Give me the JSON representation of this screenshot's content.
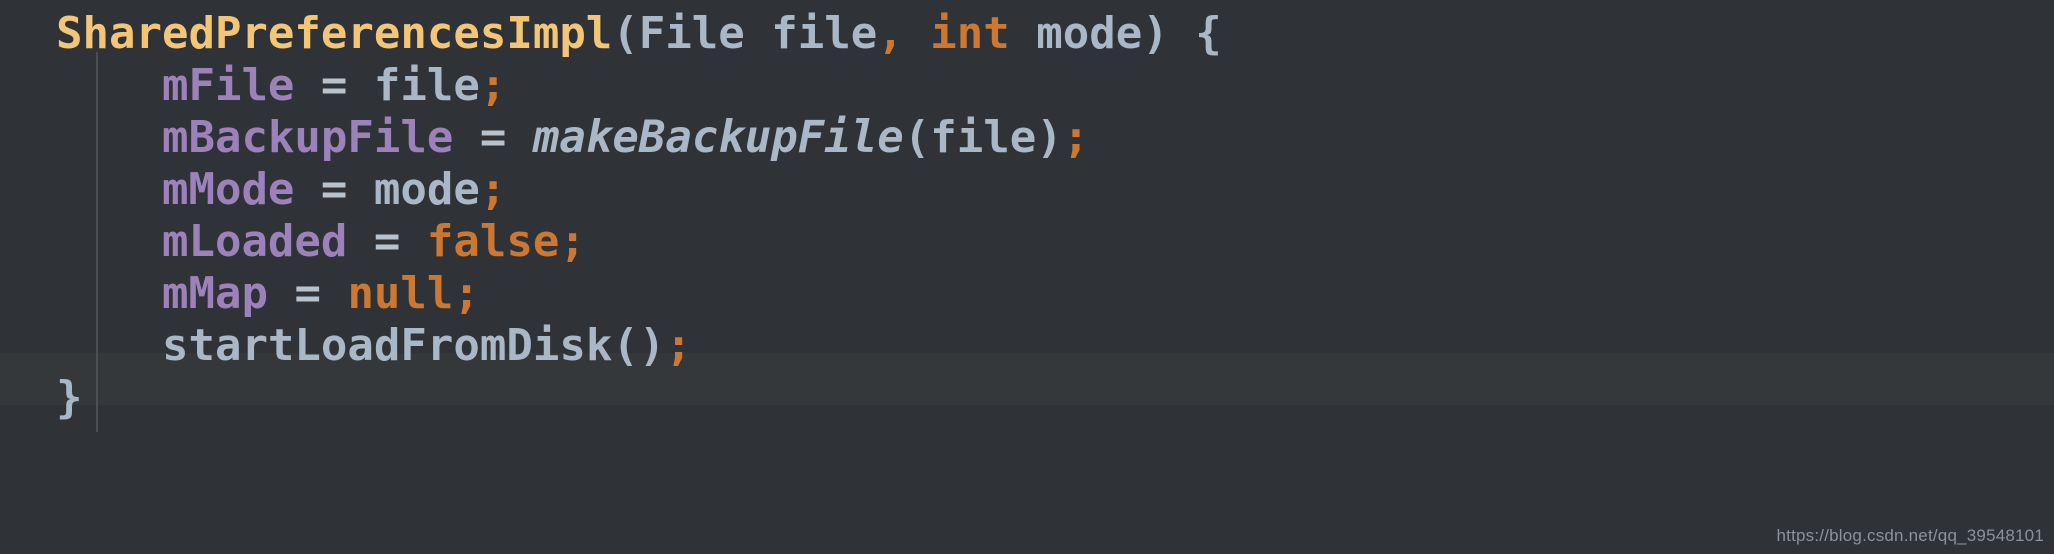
{
  "editor": {
    "theme_name": "darcula",
    "background_color": "#2f3337",
    "caret_line_color": "#35383a",
    "indent_guide_color": "#4a4f52",
    "highlighted_line_number": 6,
    "language": "java",
    "colors": {
      "constructor": "#f3c677",
      "keyword": "#cc7832",
      "punctuation": "#cc7832",
      "field": "#9d81bb",
      "plain": "#a9b7c6",
      "operator": "#b8c2cc",
      "static_method": "#a9b7c6"
    },
    "lines": [
      {
        "id": "line-1",
        "indent": "",
        "tokens": [
          {
            "text": "SharedPreferencesImpl",
            "kind": "ctor"
          },
          {
            "text": "(",
            "kind": "plain"
          },
          {
            "text": "File",
            "kind": "plain"
          },
          {
            "text": " ",
            "kind": "plain"
          },
          {
            "text": "file",
            "kind": "plain"
          },
          {
            "text": ",",
            "kind": "punc"
          },
          {
            "text": " ",
            "kind": "plain"
          },
          {
            "text": "int",
            "kind": "kw"
          },
          {
            "text": " ",
            "kind": "plain"
          },
          {
            "text": "mode",
            "kind": "plain"
          },
          {
            "text": ")",
            "kind": "plain"
          },
          {
            "text": " ",
            "kind": "plain"
          },
          {
            "text": "{",
            "kind": "plain"
          }
        ]
      },
      {
        "id": "line-2",
        "indent": "    ",
        "tokens": [
          {
            "text": "mFile",
            "kind": "field"
          },
          {
            "text": " ",
            "kind": "plain"
          },
          {
            "text": "=",
            "kind": "op"
          },
          {
            "text": " ",
            "kind": "plain"
          },
          {
            "text": "file",
            "kind": "plain"
          },
          {
            "text": ";",
            "kind": "punc"
          }
        ]
      },
      {
        "id": "line-3",
        "indent": "    ",
        "tokens": [
          {
            "text": "mBackupFile",
            "kind": "field"
          },
          {
            "text": " ",
            "kind": "plain"
          },
          {
            "text": "=",
            "kind": "op"
          },
          {
            "text": " ",
            "kind": "plain"
          },
          {
            "text": "makeBackupFile",
            "kind": "method"
          },
          {
            "text": "(",
            "kind": "plain"
          },
          {
            "text": "file",
            "kind": "plain"
          },
          {
            "text": ")",
            "kind": "plain"
          },
          {
            "text": ";",
            "kind": "punc"
          }
        ]
      },
      {
        "id": "line-4",
        "indent": "    ",
        "tokens": [
          {
            "text": "mMode",
            "kind": "field"
          },
          {
            "text": " ",
            "kind": "plain"
          },
          {
            "text": "=",
            "kind": "op"
          },
          {
            "text": " ",
            "kind": "plain"
          },
          {
            "text": "mode",
            "kind": "plain"
          },
          {
            "text": ";",
            "kind": "punc"
          }
        ]
      },
      {
        "id": "line-5",
        "indent": "    ",
        "tokens": [
          {
            "text": "mLoaded",
            "kind": "field"
          },
          {
            "text": " ",
            "kind": "plain"
          },
          {
            "text": "=",
            "kind": "op"
          },
          {
            "text": " ",
            "kind": "plain"
          },
          {
            "text": "false",
            "kind": "kw"
          },
          {
            "text": ";",
            "kind": "punc"
          }
        ]
      },
      {
        "id": "line-6",
        "indent": "    ",
        "highlighted": true,
        "tokens": [
          {
            "text": "mMap",
            "kind": "field"
          },
          {
            "text": " ",
            "kind": "plain"
          },
          {
            "text": "=",
            "kind": "op"
          },
          {
            "text": " ",
            "kind": "plain"
          },
          {
            "text": "null",
            "kind": "kw"
          },
          {
            "text": ";",
            "kind": "punc"
          }
        ]
      },
      {
        "id": "line-7",
        "indent": "    ",
        "tokens": [
          {
            "text": "startLoadFromDisk",
            "kind": "call"
          },
          {
            "text": "(",
            "kind": "plain"
          },
          {
            "text": ")",
            "kind": "plain"
          },
          {
            "text": ";",
            "kind": "punc"
          }
        ]
      },
      {
        "id": "line-8",
        "indent": "",
        "tokens": [
          {
            "text": "}",
            "kind": "plain"
          }
        ]
      }
    ]
  },
  "watermark": {
    "text": "https://blog.csdn.net/qq_39548101"
  }
}
